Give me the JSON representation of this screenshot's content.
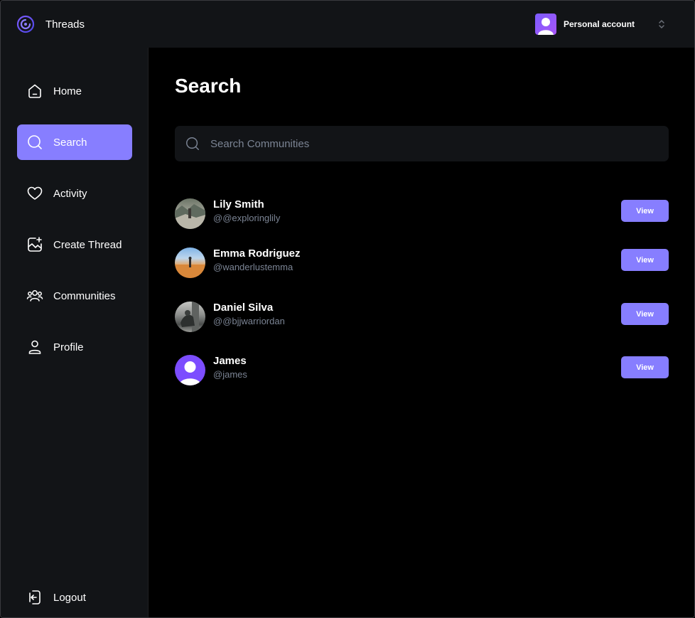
{
  "app": {
    "name": "Threads"
  },
  "account": {
    "label": "Personal account"
  },
  "sidebar": {
    "items": [
      {
        "label": "Home",
        "icon": "home-icon"
      },
      {
        "label": "Search",
        "icon": "search-icon",
        "active": true
      },
      {
        "label": "Activity",
        "icon": "heart-icon"
      },
      {
        "label": "Create Thread",
        "icon": "create-thread-icon"
      },
      {
        "label": "Communities",
        "icon": "communities-icon"
      },
      {
        "label": "Profile",
        "icon": "profile-icon"
      }
    ],
    "logout": {
      "label": "Logout",
      "icon": "logout-icon"
    }
  },
  "main": {
    "title": "Search",
    "search": {
      "placeholder": "Search Communities",
      "value": ""
    },
    "users": [
      {
        "name": "Lily Smith",
        "handle": "@@exploringlily",
        "button": "View"
      },
      {
        "name": "Emma Rodriguez",
        "handle": "@wanderlustemma",
        "button": "View"
      },
      {
        "name": "Daniel Silva",
        "handle": "@@bjjwarriordan",
        "button": "View"
      },
      {
        "name": "James",
        "handle": "@james",
        "button": "View"
      }
    ]
  },
  "colors": {
    "accent": "#877eff",
    "sidebar_bg": "#121417",
    "muted_text": "#7b8494"
  }
}
